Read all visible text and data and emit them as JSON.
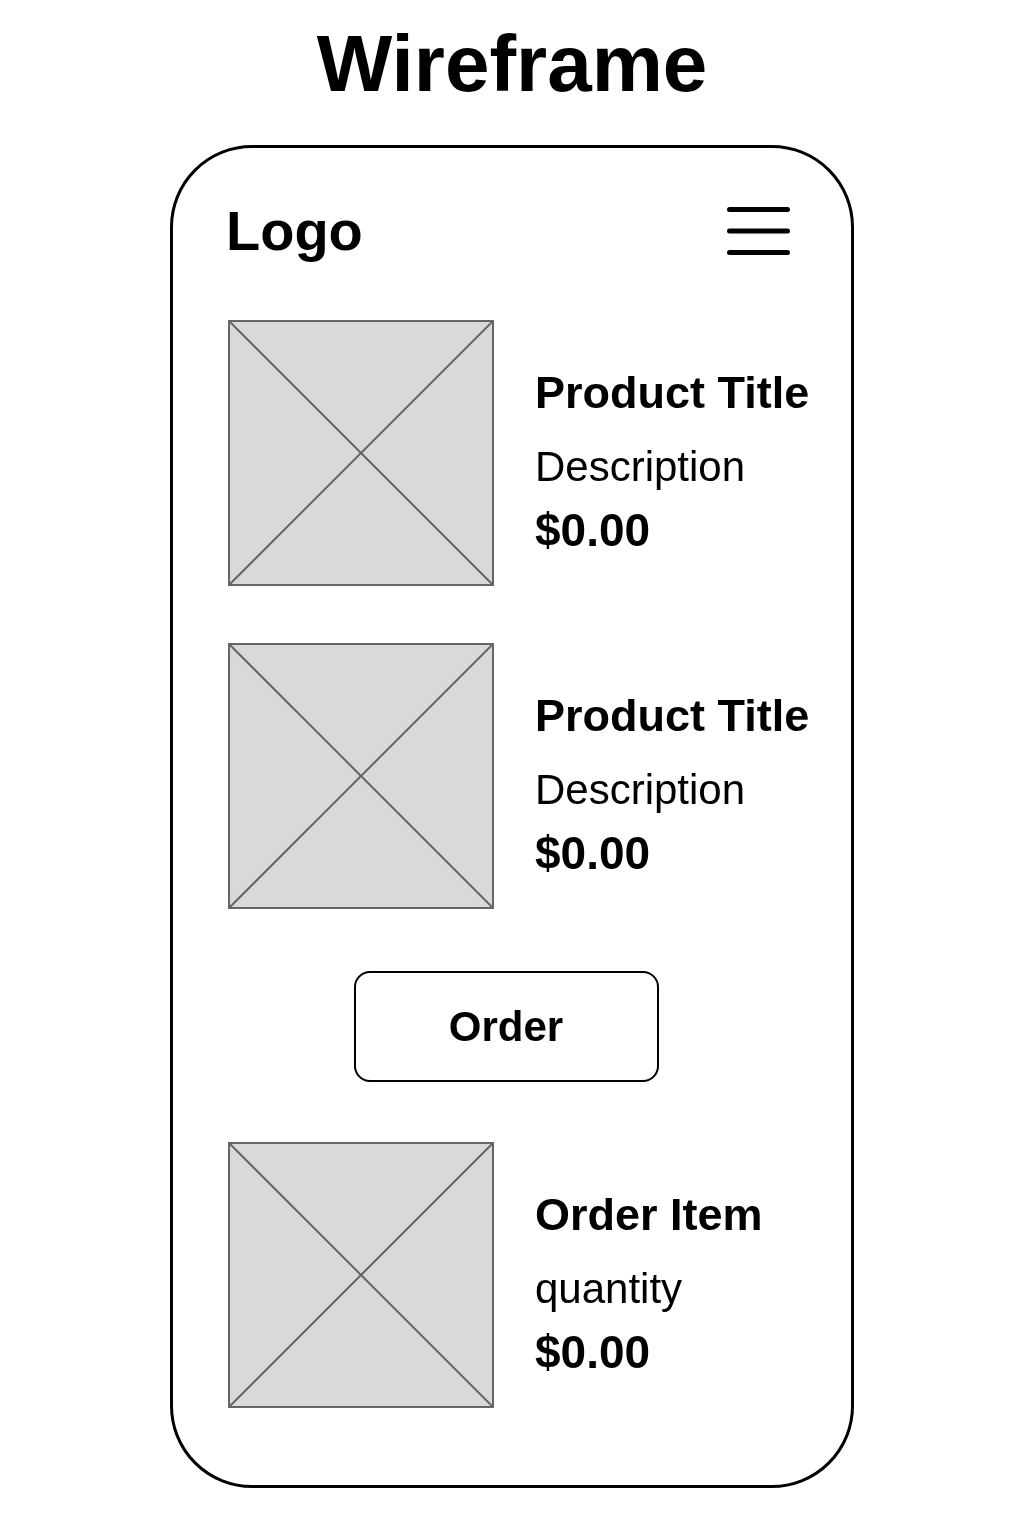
{
  "title": "Wireframe",
  "header": {
    "logo": "Logo"
  },
  "products": [
    {
      "title": "Product Title",
      "description": "Description",
      "price": "$0.00"
    },
    {
      "title": "Product Title",
      "description": "Description",
      "price": "$0.00"
    }
  ],
  "order_button": {
    "label": "Order"
  },
  "order_items": [
    {
      "title": "Order Item",
      "quantity": "quantity",
      "price": "$0.00"
    }
  ]
}
